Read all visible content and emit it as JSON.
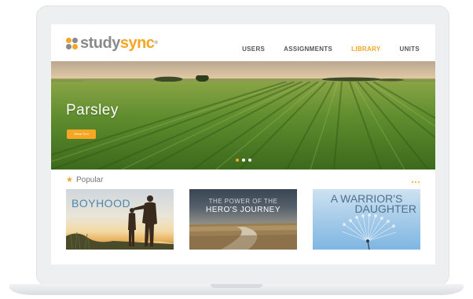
{
  "brand": {
    "name_part1": "study",
    "name_part2": "sync",
    "trademark": "®",
    "colors": {
      "accent": "#f5a623",
      "gray": "#8a8a8a"
    }
  },
  "nav": {
    "items": [
      {
        "label": "USERS",
        "active": false
      },
      {
        "label": "ASSIGNMENTS",
        "active": false
      },
      {
        "label": "LIBRARY",
        "active": true
      },
      {
        "label": "UNITS",
        "active": false
      }
    ]
  },
  "hero": {
    "title": "Parsley",
    "button_label": "Show Text",
    "slides_total": 3,
    "active_slide": 1
  },
  "popular": {
    "title": "Popular",
    "icons": {
      "title_icon": "star-icon",
      "more_icon": "more-icon"
    },
    "cards": [
      {
        "title": "BOYHOOD"
      },
      {
        "title_line1": "THE POWER OF THE",
        "title_line2": "HERO'S JOURNEY"
      },
      {
        "title_line1": "A WARRIOR'S",
        "title_line2": "DAUGHTER"
      }
    ]
  }
}
